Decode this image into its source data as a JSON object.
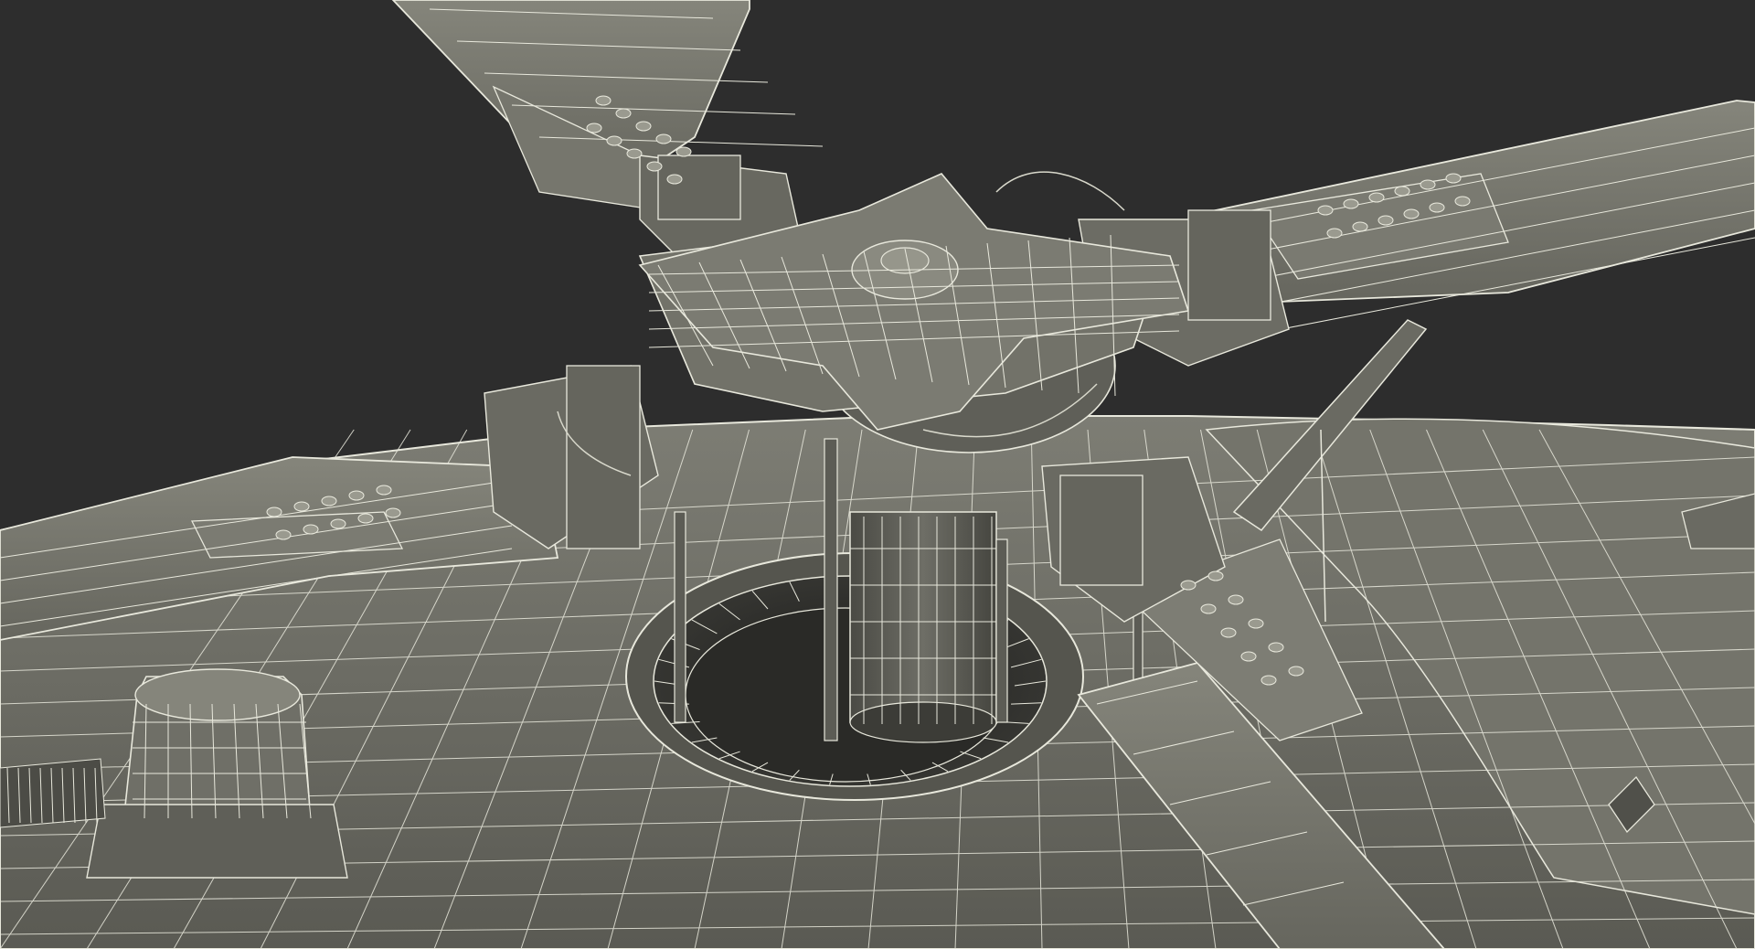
{
  "scene": {
    "subject": "helicopter-main-rotor-hub",
    "render_style": "wireframe-over-shaded",
    "rotor_blade_count": 4,
    "colors": {
      "background": "#2d2d2d",
      "surface": "#6f6f67",
      "surface_light": "#8a8a80",
      "surface_dark": "#4b4b45",
      "shadow": "#262624",
      "wire": "#e8e8dc",
      "wire_dim": "#bdbdb2"
    }
  }
}
